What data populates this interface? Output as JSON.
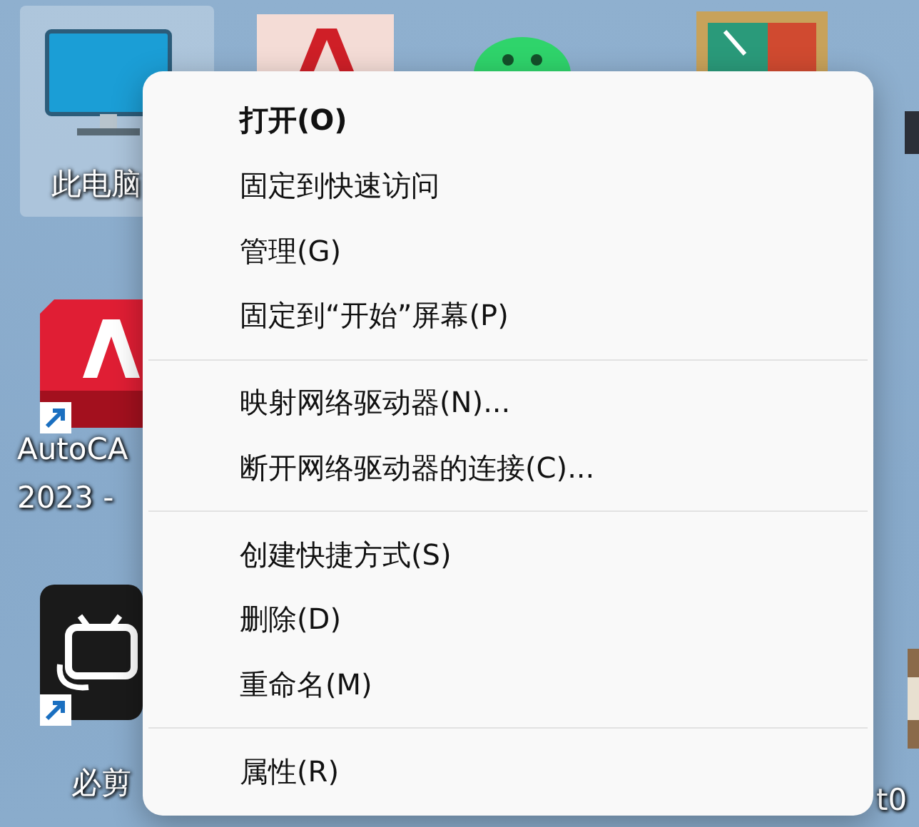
{
  "desktop": {
    "icons": [
      {
        "kind": "monitor",
        "label": "此电脑",
        "selected": true,
        "shortcut": false
      },
      {
        "kind": "autocad-top",
        "selected": false,
        "shortcut": false
      },
      {
        "kind": "chat",
        "selected": false,
        "shortcut": false
      },
      {
        "kind": "photo-frame",
        "selected": false,
        "shortcut": false
      },
      {
        "kind": "dark-tile",
        "selected": false,
        "shortcut": false
      },
      {
        "kind": "autocad",
        "label": "AutoCA\n2023 - ",
        "selected": false,
        "shortcut": true
      },
      {
        "kind": "video-app",
        "label": "必剪",
        "selected": false,
        "shortcut": true
      },
      {
        "kind": "photo",
        "label": "t0",
        "selected": false,
        "shortcut": false
      }
    ]
  },
  "context_menu": {
    "sections": [
      [
        {
          "label": "打开(O)",
          "default": true
        },
        {
          "label": "固定到快速访问",
          "default": false
        },
        {
          "label": "管理(G)",
          "default": false
        },
        {
          "label": "固定到“开始”屏幕(P)",
          "default": false
        }
      ],
      [
        {
          "label": "映射网络驱动器(N)...",
          "default": false
        },
        {
          "label": "断开网络驱动器的连接(C)...",
          "default": false
        }
      ],
      [
        {
          "label": "创建快捷方式(S)",
          "default": false
        },
        {
          "label": "删除(D)",
          "default": false
        },
        {
          "label": "重命名(M)",
          "default": false
        }
      ],
      [
        {
          "label": "属性(R)",
          "default": false
        }
      ]
    ]
  }
}
